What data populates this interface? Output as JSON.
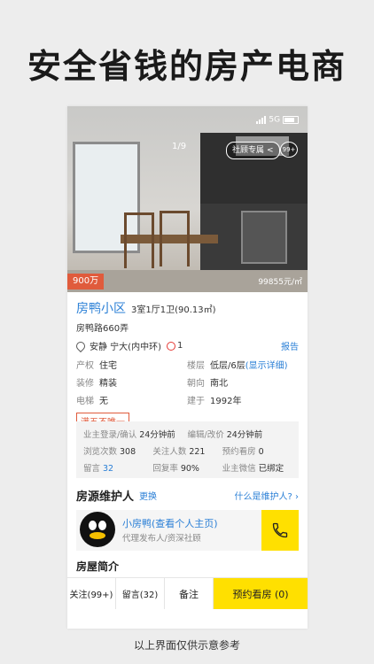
{
  "headline": "安全省钱的房产电商",
  "footer_note": "以上界面仅供示意参考",
  "status": {
    "network": "5G"
  },
  "gallery": {
    "counter": "1/9",
    "share_label": "社顾专属",
    "views_badge": "99+"
  },
  "price": {
    "total": "900万",
    "unit": "99855元/㎡"
  },
  "listing": {
    "community": "房鸭小区",
    "layout": "3室1厅1卫(90.13㎡)",
    "address": "房鸭路660弄",
    "location": "安静 宁大(内中环)",
    "metro_count": "1",
    "report": "报告",
    "specs": [
      {
        "key": "产权",
        "value": "住宅",
        "link": ""
      },
      {
        "key": "楼层",
        "value": "低层/6层",
        "link": "(显示详细)"
      },
      {
        "key": "装修",
        "value": "精装",
        "link": ""
      },
      {
        "key": "朝向",
        "value": "南北",
        "link": ""
      },
      {
        "key": "电梯",
        "value": "无",
        "link": ""
      },
      {
        "key": "建于",
        "value": "1992年",
        "link": ""
      }
    ],
    "tag": "满五不唯一"
  },
  "stats": [
    [
      {
        "key": "业主登录/确认",
        "value": "24分钟前"
      },
      {
        "key": "编辑/改价",
        "value": "24分钟前"
      }
    ],
    [
      {
        "key": "浏览次数",
        "value": "308"
      },
      {
        "key": "关注人数",
        "value": "221"
      },
      {
        "key": "预约看房",
        "value": "0"
      }
    ],
    [
      {
        "key": "留言",
        "value": "32"
      },
      {
        "key": "回复率",
        "value": "90%"
      },
      {
        "key": "业主微信",
        "value": "已绑定"
      }
    ]
  ],
  "agent": {
    "section_title": "房源维护人",
    "swap_label": "更换",
    "what_label": "什么是维护人? ›",
    "name": "小房鸭(查看个人主页)",
    "role": "代理发布人/资深社顾"
  },
  "intro_title": "房屋简介",
  "bottom_bar": {
    "follow": "关注(99+)",
    "message": "留言(32)",
    "note": "备注",
    "book": "预约看房 (0)"
  },
  "colors": {
    "accent_yellow": "#ffe000",
    "link_blue": "#2a7fd6",
    "price_red": "#e05b3c"
  }
}
